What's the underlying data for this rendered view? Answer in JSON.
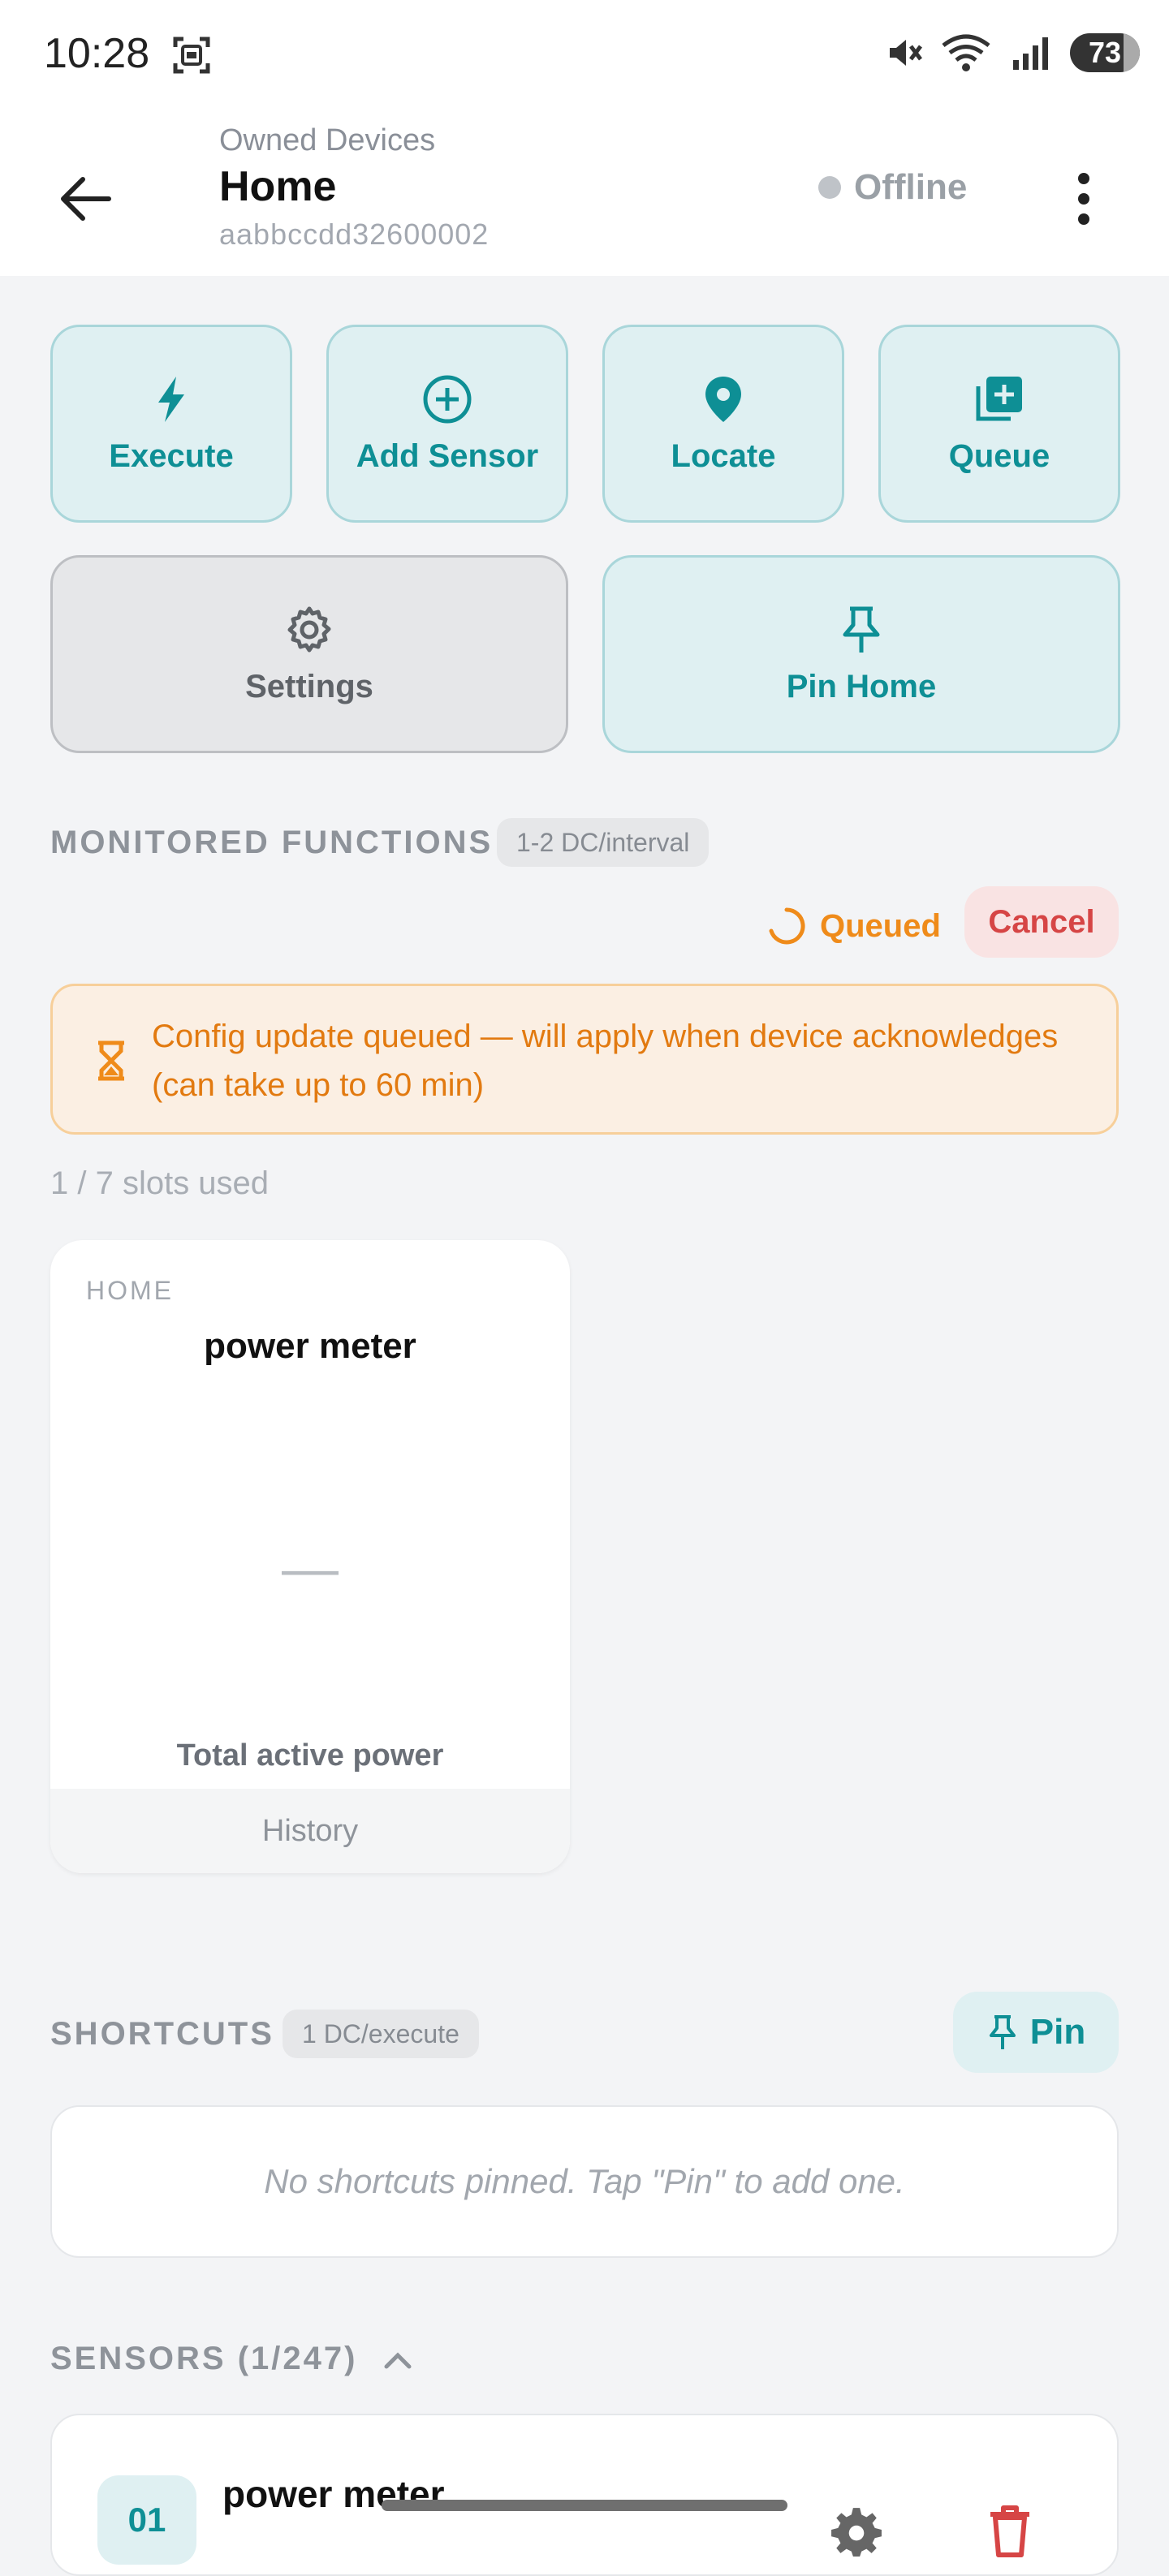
{
  "status_bar": {
    "time": "10:28",
    "battery": "73"
  },
  "header": {
    "subtitle": "Owned Devices",
    "title": "Home",
    "device_id": "aabbccdd32600002",
    "status": "Offline"
  },
  "actions": {
    "execute": "Execute",
    "add_sensor": "Add Sensor",
    "locate": "Locate",
    "queue": "Queue",
    "settings": "Settings",
    "pin_home": "Pin Home"
  },
  "monitored": {
    "label": "MONITORED FUNCTIONS",
    "chip": "1-2 DC/interval",
    "queued": "Queued",
    "cancel": "Cancel",
    "banner": "Config update queued — will apply when device acknowledges (can take up to 60 min)",
    "slots": "1 / 7 slots used",
    "card": {
      "kicker": "HOME",
      "title": "power meter",
      "value": "—",
      "metric": "Total active power",
      "history": "History"
    }
  },
  "shortcuts": {
    "label": "SHORTCUTS",
    "chip": "1 DC/execute",
    "pin": "Pin",
    "empty": "No shortcuts pinned. Tap \"Pin\" to add one."
  },
  "sensors": {
    "label": "SENSORS (1/247)",
    "items": [
      {
        "num": "01",
        "name": "power meter"
      }
    ]
  },
  "colors": {
    "accent": "#0e8f95",
    "warning": "#ef8b1a",
    "danger": "#d64545"
  }
}
